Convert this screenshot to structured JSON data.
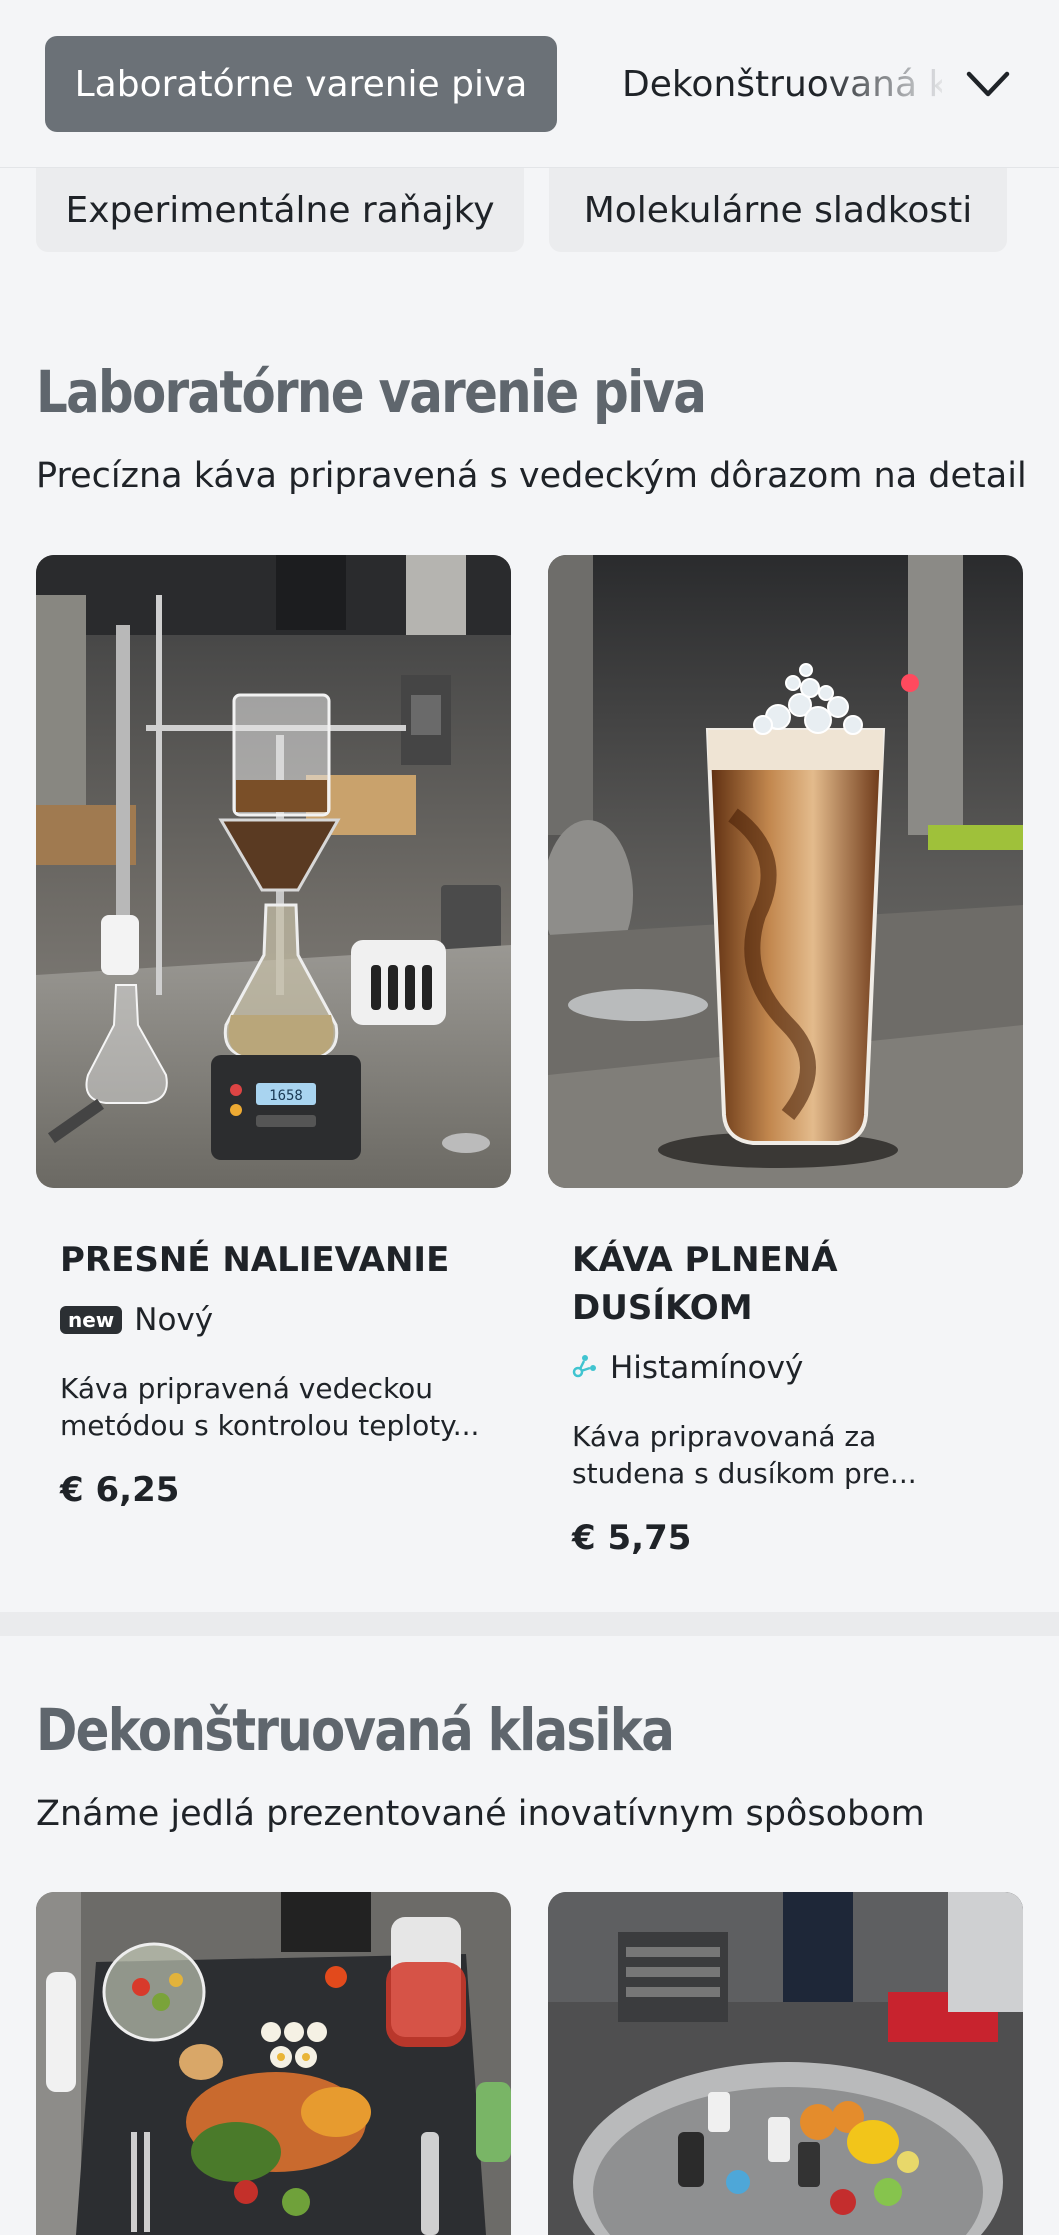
{
  "nav": {
    "active_tab": "Laboratórne varenie piva",
    "next_tab": "Dekonštruovaná klasika",
    "chips": [
      "Experimentálne raňajky",
      "Molekulárne sladkosti"
    ]
  },
  "sections": [
    {
      "title": "Laboratórne varenie piva",
      "subtitle": "Precízna káva pripravená s vedeckým dôrazom na detail",
      "items": [
        {
          "name": "PRESNÉ NALIEVANIE",
          "tag_icon": "new-badge-icon",
          "tag_badge_text": "new",
          "tag": "Nový",
          "description": "Káva pripravená vedeckou metódou s kontrolou teploty...",
          "price": "€ 6,25"
        },
        {
          "name": "KÁVA PLNENÁ DUSÍKOM",
          "tag_icon": "molecule-icon",
          "tag": "Histamínový",
          "description": "Káva pripravovaná za studena s dusíkom pre...",
          "price": "€ 5,75"
        }
      ]
    },
    {
      "title": "Dekonštruovaná klasika",
      "subtitle": "Známe jedlá prezentované inovatívnym spôsobom",
      "items": []
    }
  ],
  "scale_display": "1658",
  "colors": {
    "active_tab_bg": "#6b7177",
    "title_gray": "#5f666d",
    "histamine_icon": "#40c4d0"
  }
}
